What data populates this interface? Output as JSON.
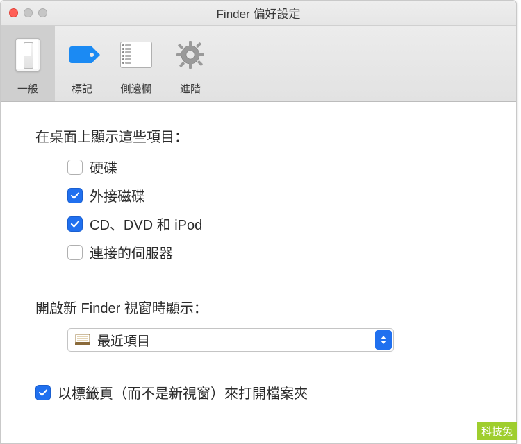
{
  "window": {
    "title": "Finder 偏好設定"
  },
  "toolbar": {
    "items": [
      {
        "label": "一般",
        "selected": true
      },
      {
        "label": "標記",
        "selected": false
      },
      {
        "label": "側邊欄",
        "selected": false
      },
      {
        "label": "進階",
        "selected": false
      }
    ]
  },
  "desktop_section": {
    "heading": "在桌面上顯示這些項目：",
    "items": [
      {
        "label": "硬碟",
        "checked": false
      },
      {
        "label": "外接磁碟",
        "checked": true
      },
      {
        "label": "CD、DVD 和 iPod",
        "checked": true
      },
      {
        "label": "連接的伺服器",
        "checked": false
      }
    ]
  },
  "new_window_section": {
    "heading": "開啟新 Finder 視窗時顯示：",
    "dropdown": {
      "selected_label": "最近項目"
    }
  },
  "tabs_checkbox": {
    "label": "以標籤頁（而不是新視窗）來打開檔案夾",
    "checked": true
  },
  "watermark": "科技兔"
}
